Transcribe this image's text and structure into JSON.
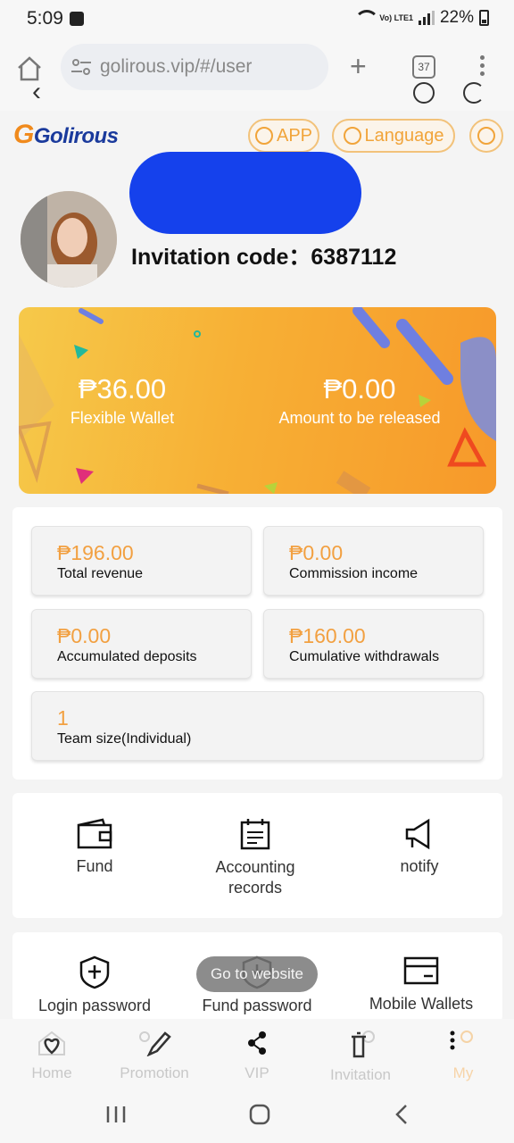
{
  "status": {
    "time": "5:09",
    "lte": "Vo) LTE1",
    "battery": "22%"
  },
  "browser": {
    "url": "golirous.vip/#/user",
    "tabs_count": "37"
  },
  "header": {
    "logo_text": "Golirous",
    "app_label": "APP",
    "language_label": "Language"
  },
  "profile": {
    "invitation_label": "Invitation code：",
    "invitation_code": "6387112"
  },
  "wallet": {
    "flexible_amount": "₱36.00",
    "flexible_label": "Flexible Wallet",
    "release_amount": "₱0.00",
    "release_label": "Amount to be released"
  },
  "stats": [
    {
      "value": "₱196.00",
      "label": "Total revenue"
    },
    {
      "value": "₱0.00",
      "label": "Commission income"
    },
    {
      "value": "₱0.00",
      "label": "Accumulated deposits"
    },
    {
      "value": "₱160.00",
      "label": "Cumulative withdrawals"
    },
    {
      "value": "1",
      "label": "Team size(Individual)"
    }
  ],
  "menu1": [
    {
      "label": "Fund",
      "icon": "wallet-icon"
    },
    {
      "label": "Accounting records",
      "icon": "calendar-icon"
    },
    {
      "label": "notify",
      "icon": "megaphone-icon"
    }
  ],
  "menu2": [
    {
      "label": "Login password",
      "icon": "shield-plus-icon"
    },
    {
      "label": "Fund password",
      "icon": "shield-icon"
    },
    {
      "label": "Mobile Wallets",
      "icon": "card-icon"
    }
  ],
  "toast": "Go to website",
  "bottomnav": [
    {
      "label": "Home",
      "icon": "home-icon"
    },
    {
      "label": "Promotion",
      "icon": "promotion-icon"
    },
    {
      "label": "VIP",
      "icon": "vip-icon"
    },
    {
      "label": "Invitation",
      "icon": "invitation-icon"
    },
    {
      "label": "My",
      "icon": "user-icon"
    }
  ],
  "colors": {
    "accent": "#f2a041",
    "brand_blue": "#1a3a9c",
    "redaction": "#1541ec"
  }
}
